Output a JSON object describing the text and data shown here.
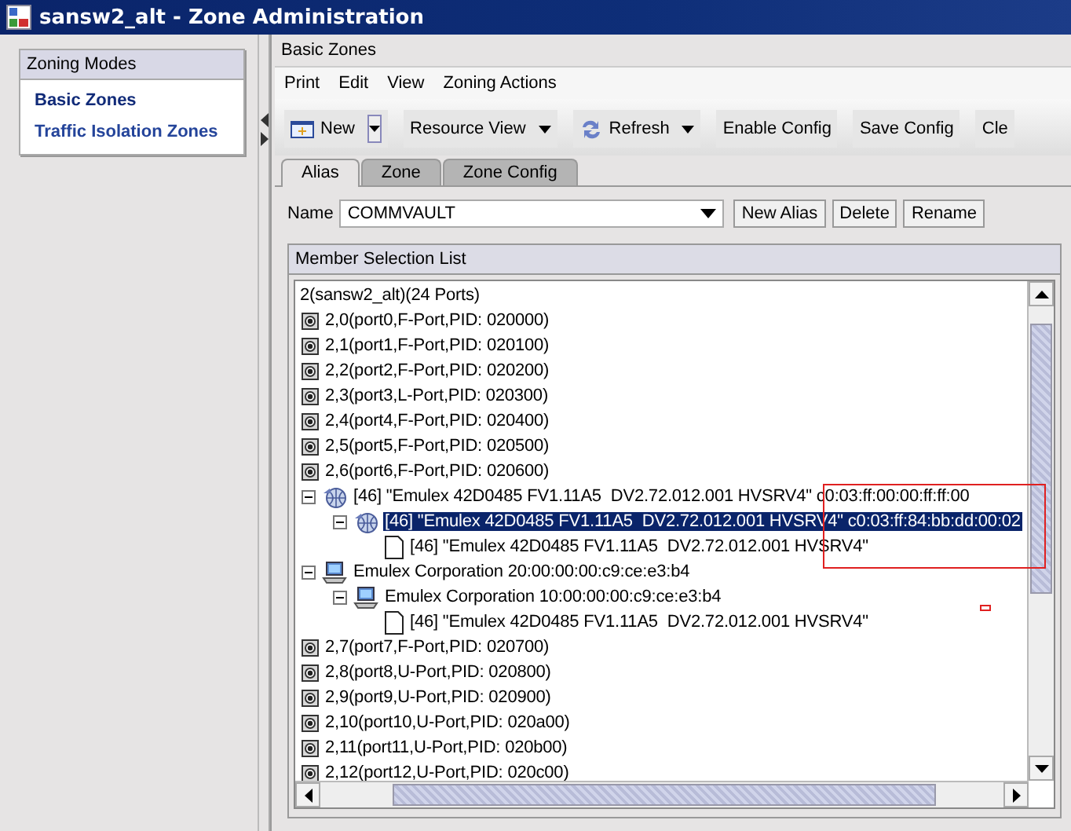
{
  "window": {
    "title": "sansw2_alt - Zone Administration"
  },
  "sidebar": {
    "title": "Zoning Modes",
    "items": [
      {
        "label": "Basic Zones",
        "selected": true
      },
      {
        "label": "Traffic Isolation Zones",
        "selected": false
      }
    ]
  },
  "panel": {
    "title": "Basic Zones"
  },
  "menu": [
    "Print",
    "Edit",
    "View",
    "Zoning Actions"
  ],
  "toolbar": [
    {
      "label": "New",
      "kind": "new",
      "split": true
    },
    {
      "label": "Resource View",
      "kind": "plain",
      "dropdown": true,
      "split": false
    },
    {
      "label": "Refresh",
      "kind": "refresh",
      "dropdown": true,
      "split": false
    },
    {
      "label": "Enable Config",
      "kind": "plain",
      "dropdown": false,
      "split": false
    },
    {
      "label": "Save Config",
      "kind": "plain",
      "dropdown": false,
      "split": false
    },
    {
      "label": "Cle",
      "kind": "plain",
      "dropdown": false,
      "split": false
    }
  ],
  "tabs": [
    {
      "label": "Alias",
      "selected": true
    },
    {
      "label": "Zone",
      "selected": false
    },
    {
      "label": "Zone Config",
      "selected": false
    }
  ],
  "name_field": {
    "label": "Name",
    "value": "COMMVAULT"
  },
  "buttons": [
    "New Alias",
    "Delete",
    "Rename"
  ],
  "member_list": {
    "title": "Member Selection List",
    "tree": {
      "label": "2(sansw2_alt)(24 Ports)",
      "selected": false,
      "children": [
        {
          "label": "2,0(port0,F-Port,PID: 020000)",
          "kind": "port",
          "selected": false
        },
        {
          "label": "2,1(port1,F-Port,PID: 020100)",
          "kind": "port",
          "selected": false
        },
        {
          "label": "2,2(port2,F-Port,PID: 020200)",
          "kind": "port",
          "selected": false
        },
        {
          "label": "2,3(port3,L-Port,PID: 020300)",
          "kind": "port",
          "selected": false
        },
        {
          "label": "2,4(port4,F-Port,PID: 020400)",
          "kind": "port",
          "selected": false
        },
        {
          "label": "2,5(port5,F-Port,PID: 020500)",
          "kind": "port",
          "selected": false
        },
        {
          "label": "2,6(port6,F-Port,PID: 020600)",
          "kind": "port",
          "selected": false
        },
        {
          "label": "[46] \"Emulex 42D0485 FV1.11A5  DV2.72.012.001 HVSRV4\" c0:03:ff:00:00:ff:ff:00",
          "kind": "globe",
          "expanded": true,
          "selected": false,
          "children": [
            {
              "label": "[46] \"Emulex 42D0485 FV1.11A5  DV2.72.012.001 HVSRV4\" c0:03:ff:84:bb:dd:00:02",
              "kind": "globe",
              "expanded": true,
              "selected": true,
              "children": [
                {
                  "label": "[46] \"Emulex 42D0485 FV1.11A5  DV2.72.012.001 HVSRV4\"",
                  "kind": "document",
                  "selected": false
                }
              ]
            }
          ]
        },
        {
          "label": "Emulex Corporation 20:00:00:00:c9:ce:e3:b4",
          "kind": "host",
          "expanded": true,
          "selected": false,
          "children": [
            {
              "label": "Emulex Corporation 10:00:00:00:c9:ce:e3:b4",
              "kind": "host",
              "expanded": true,
              "selected": false,
              "children": [
                {
                  "label": "[46] \"Emulex 42D0485 FV1.11A5  DV2.72.012.001 HVSRV4\"",
                  "kind": "document",
                  "selected": false
                }
              ]
            }
          ]
        },
        {
          "label": "2,7(port7,F-Port,PID: 020700)",
          "kind": "port",
          "selected": false
        },
        {
          "label": "2,8(port8,U-Port,PID: 020800)",
          "kind": "port",
          "selected": false
        },
        {
          "label": "2,9(port9,U-Port,PID: 020900)",
          "kind": "port",
          "selected": false
        },
        {
          "label": "2,10(port10,U-Port,PID: 020a00)",
          "kind": "port",
          "selected": false
        },
        {
          "label": "2,11(port11,U-Port,PID: 020b00)",
          "kind": "port",
          "selected": false
        },
        {
          "label": "2,12(port12,U-Port,PID: 020c00)",
          "kind": "port",
          "selected": false
        }
      ]
    }
  }
}
